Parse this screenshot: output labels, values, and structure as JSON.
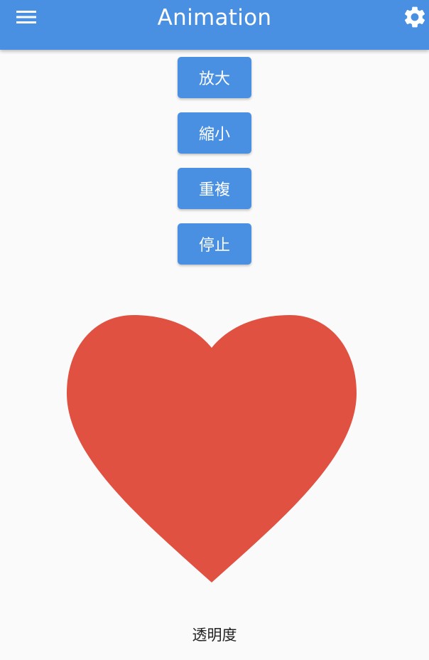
{
  "appbar": {
    "title": "Animation",
    "color": "#4a90e2",
    "menu_icon": "hamburger-menu-icon",
    "settings_icon": "gear-icon"
  },
  "actions": [
    {
      "label": "放大"
    },
    {
      "label": "縮小"
    },
    {
      "label": "重複"
    },
    {
      "label": "停止"
    }
  ],
  "button_color": "#4a90e2",
  "heart": {
    "icon": "heart-icon",
    "color": "#e05142"
  },
  "caption": "透明度"
}
